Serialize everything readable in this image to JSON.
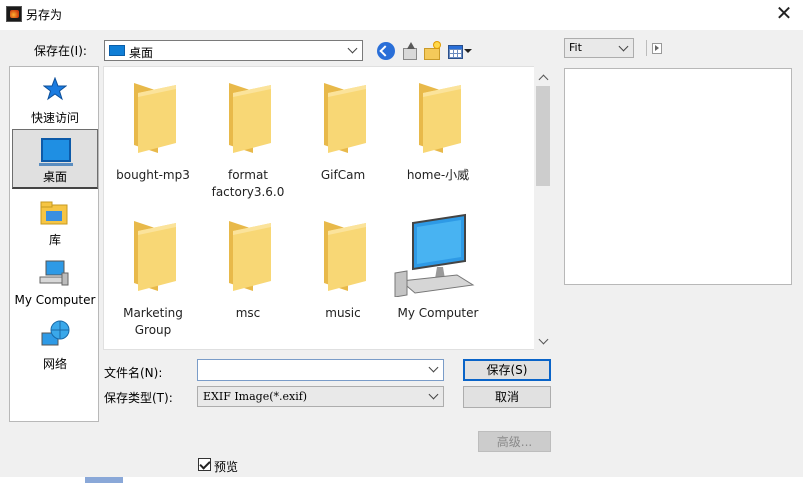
{
  "window": {
    "title": "另存为",
    "close_glyph": "✕"
  },
  "savein": {
    "label": "保存在(I):",
    "value": "桌面"
  },
  "places": [
    {
      "label": "快速访问",
      "icon": "star-icon"
    },
    {
      "label": "桌面",
      "icon": "desktop-icon",
      "selected": true
    },
    {
      "label": "库",
      "icon": "library-icon"
    },
    {
      "label": "My Computer",
      "icon": "computer-icon"
    },
    {
      "label": "网络",
      "icon": "network-icon"
    }
  ],
  "files": [
    {
      "name": "bought-mp3",
      "type": "folder"
    },
    {
      "name": "format factory3.6.0",
      "type": "folder"
    },
    {
      "name": "GifCam",
      "type": "folder"
    },
    {
      "name": "home-小威",
      "type": "folder"
    },
    {
      "name": "Marketing Group",
      "type": "folder"
    },
    {
      "name": "msc",
      "type": "folder"
    },
    {
      "name": "music",
      "type": "folder"
    },
    {
      "name": "My Computer",
      "type": "computer"
    }
  ],
  "form": {
    "filename_label": "文件名(N):",
    "filename_value": "",
    "filetype_label": "保存类型(T):",
    "filetype_value": "EXIF Image(*.exif)",
    "save_label": "保存(S)",
    "cancel_label": "取消",
    "advanced_label": "高级...",
    "preview_label": "预览",
    "preview_checked": true
  },
  "preview_panel": {
    "fit_value": "Fit"
  },
  "colors": {
    "accent": "#0a64c8",
    "folder": "#f8d775",
    "desktop": "#1f8fe3"
  }
}
